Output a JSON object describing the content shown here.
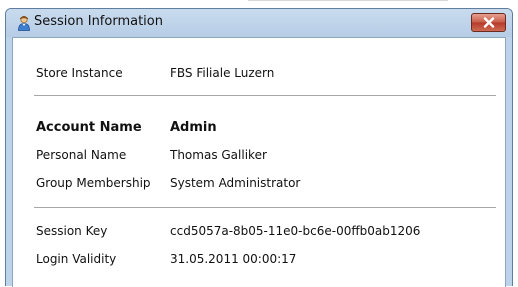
{
  "window": {
    "title": "Session Information"
  },
  "store": {
    "label": "Store Instance",
    "value": "FBS Filiale Luzern"
  },
  "account": {
    "name_label": "Account Name",
    "name_value": "Admin",
    "personal_label": "Personal Name",
    "personal_value": "Thomas Galliker",
    "group_label": "Group Membership",
    "group_value": "System Administrator"
  },
  "session": {
    "key_label": "Session Key",
    "key_value": "ccd5057a-8b05-11e0-bc6e-00ffb0ab1206",
    "validity_label": "Login Validity",
    "validity_value": "31.05.2011 00:00:17"
  },
  "icons": {
    "app": "user-icon",
    "close": "close-icon"
  },
  "colors": {
    "title_bar": "#bcd3ea",
    "close_button": "#c75a45"
  }
}
